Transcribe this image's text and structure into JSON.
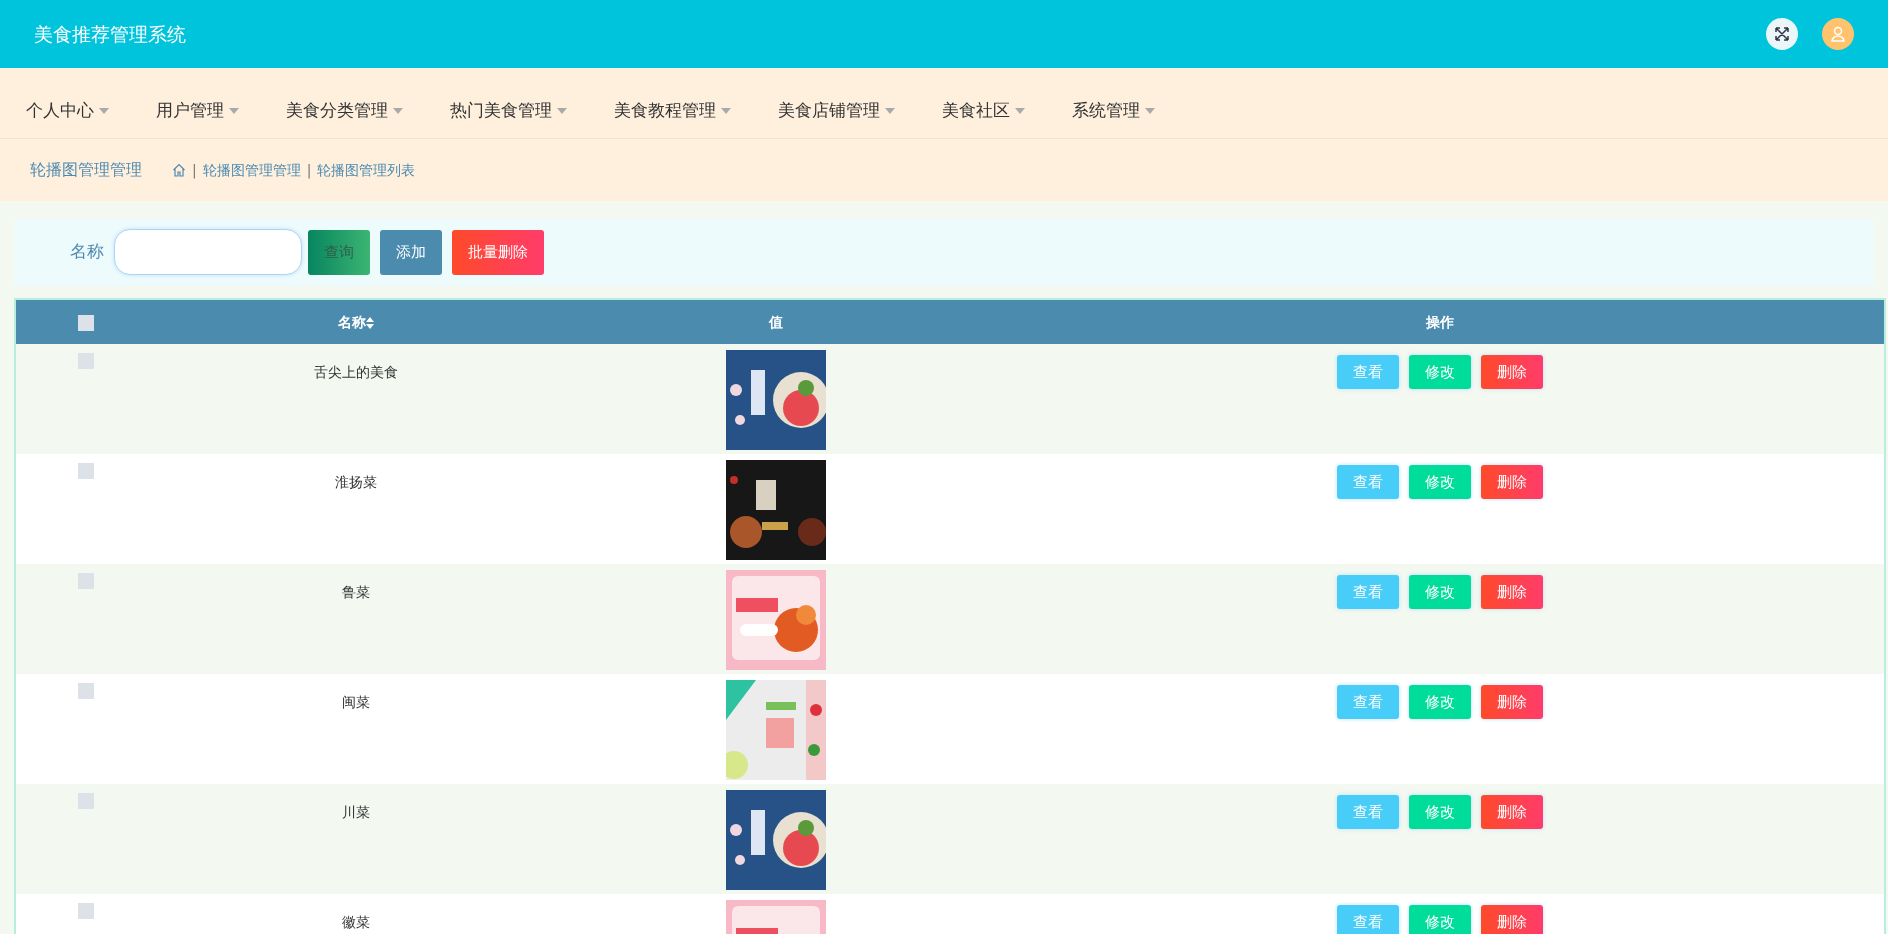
{
  "header": {
    "title": "美食推荐管理系统"
  },
  "nav": [
    {
      "label": "个人中心"
    },
    {
      "label": "用户管理"
    },
    {
      "label": "美食分类管理"
    },
    {
      "label": "热门美食管理"
    },
    {
      "label": "美食教程管理"
    },
    {
      "label": "美食店铺管理"
    },
    {
      "label": "美食社区"
    },
    {
      "label": "系统管理"
    }
  ],
  "breadcrumb": {
    "page_title": "轮播图管理管理",
    "items": [
      "轮播图管理管理",
      "轮播图管理列表"
    ],
    "separator": "|"
  },
  "search": {
    "label": "名称",
    "buttons": [
      {
        "label": "查询",
        "kind": "query"
      },
      {
        "label": "添加",
        "kind": "add"
      },
      {
        "label": "批量删除",
        "kind": "batch-delete"
      }
    ]
  },
  "table": {
    "select_all": {
      "checked": false
    },
    "columns": [
      "名称",
      "值",
      "操作"
    ],
    "rows": [
      {
        "checked": false,
        "name": "舌尖上的美食",
        "actions": [
          {
            "label": "查看",
            "kind": "view"
          },
          {
            "label": "修改",
            "kind": "edit"
          },
          {
            "label": "删除",
            "kind": "delete"
          }
        ]
      },
      {
        "checked": false,
        "name": "淮扬菜",
        "actions": [
          {
            "label": "查看",
            "kind": "view"
          },
          {
            "label": "修改",
            "kind": "edit"
          },
          {
            "label": "删除",
            "kind": "delete"
          }
        ]
      },
      {
        "checked": false,
        "name": "鲁菜",
        "actions": [
          {
            "label": "查看",
            "kind": "view"
          },
          {
            "label": "修改",
            "kind": "edit"
          },
          {
            "label": "删除",
            "kind": "delete"
          }
        ]
      },
      {
        "checked": false,
        "name": "闽菜",
        "actions": [
          {
            "label": "查看",
            "kind": "view"
          },
          {
            "label": "修改",
            "kind": "edit"
          },
          {
            "label": "删除",
            "kind": "delete"
          }
        ]
      },
      {
        "checked": false,
        "name": "川菜",
        "actions": [
          {
            "label": "查看",
            "kind": "view"
          },
          {
            "label": "修改",
            "kind": "edit"
          },
          {
            "label": "删除",
            "kind": "delete"
          }
        ]
      },
      {
        "checked": false,
        "name": "徽菜",
        "actions": [
          {
            "label": "查看",
            "kind": "view"
          },
          {
            "label": "修改",
            "kind": "edit"
          },
          {
            "label": "删除",
            "kind": "delete"
          }
        ]
      }
    ]
  }
}
